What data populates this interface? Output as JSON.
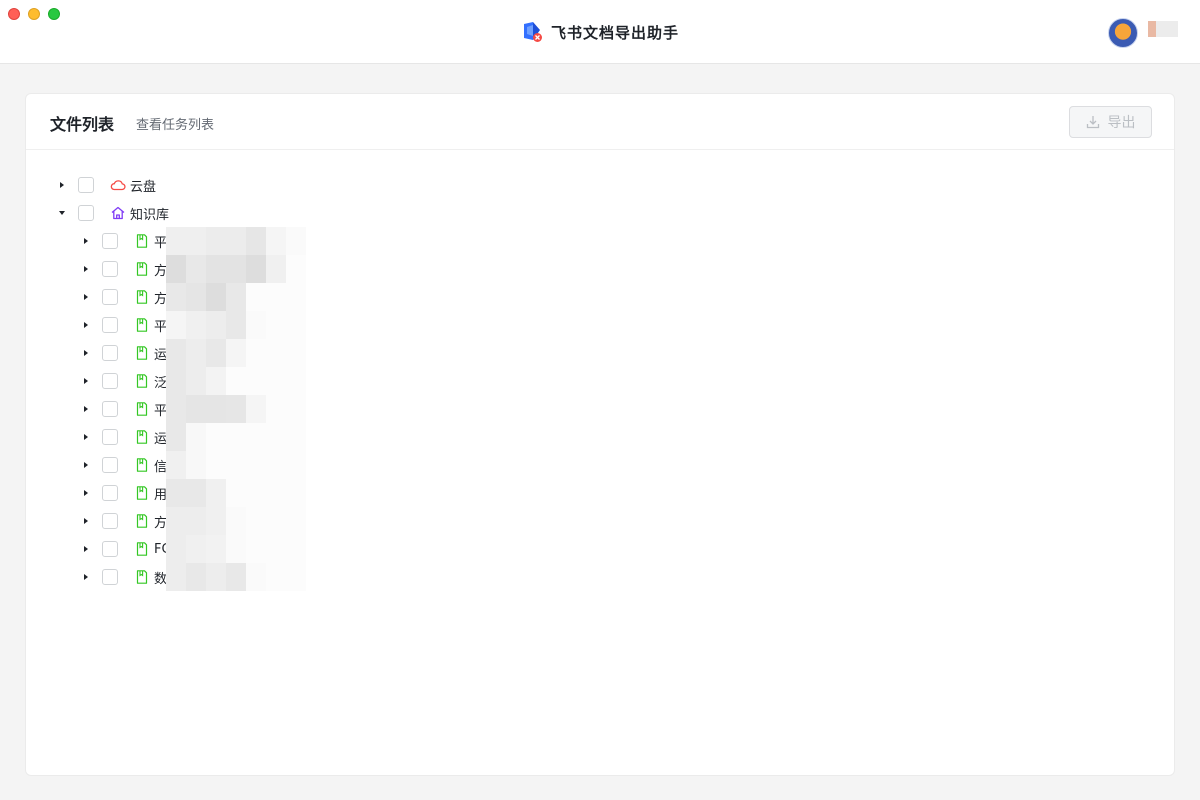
{
  "window": {
    "app_title": "飞书文档导出助手",
    "app_logo_icon": "feishu-doc-export-logo-icon",
    "avatar_icon": "user-avatar",
    "traffic_lights": [
      "close",
      "minimize",
      "maximize"
    ]
  },
  "header": {
    "tabs": [
      {
        "label": "文件列表",
        "active": true
      },
      {
        "label": "查看任务列表",
        "active": false
      }
    ],
    "export_button": {
      "label": "导出",
      "icon": "download-icon",
      "disabled": true
    }
  },
  "tree": {
    "roots": [
      {
        "label": "云盘",
        "icon": "cloud-icon",
        "expanded": false,
        "checked": false
      },
      {
        "label": "知识库",
        "icon": "home-icon",
        "expanded": true,
        "checked": false
      }
    ],
    "children": [
      {
        "label": "平",
        "icon": "document-icon",
        "expanded": false,
        "checked": false
      },
      {
        "label": "方",
        "icon": "document-icon",
        "expanded": false,
        "checked": false
      },
      {
        "label": "方",
        "icon": "document-icon",
        "expanded": false,
        "checked": false
      },
      {
        "label": "平",
        "icon": "document-icon",
        "expanded": false,
        "checked": false
      },
      {
        "label": "运",
        "icon": "document-icon",
        "expanded": false,
        "checked": false
      },
      {
        "label": "泛",
        "icon": "document-icon",
        "expanded": false,
        "checked": false
      },
      {
        "label": "平",
        "icon": "document-icon",
        "expanded": false,
        "checked": false
      },
      {
        "label": "运",
        "icon": "document-icon",
        "expanded": false,
        "checked": false
      },
      {
        "label": "信",
        "icon": "document-icon",
        "expanded": false,
        "checked": false
      },
      {
        "label": "用",
        "icon": "document-icon",
        "expanded": false,
        "checked": false
      },
      {
        "label": "方",
        "icon": "document-icon",
        "expanded": false,
        "checked": false
      },
      {
        "label": "FC",
        "icon": "document-icon",
        "expanded": false,
        "checked": false
      },
      {
        "label": "数",
        "icon": "document-icon",
        "expanded": false,
        "checked": false
      }
    ]
  },
  "colors": {
    "cloud_icon": "#f54a45",
    "home_icon": "#7f3bf5",
    "document_icon": "#34c724",
    "accent_blue": "#3370ff"
  }
}
